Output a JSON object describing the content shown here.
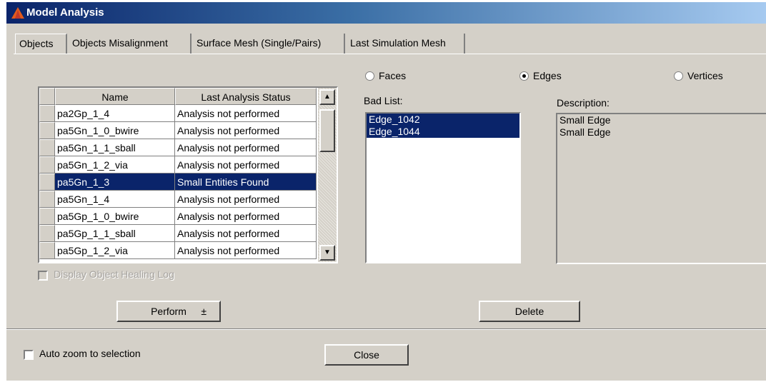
{
  "window": {
    "title": "Model Analysis"
  },
  "tabs": [
    {
      "label": "Objects",
      "active": true
    },
    {
      "label": "Objects Misalignment",
      "active": false
    },
    {
      "label": "Surface Mesh (Single/Pairs)",
      "active": false
    },
    {
      "label": "Last Simulation Mesh",
      "active": false
    }
  ],
  "table": {
    "columns": [
      "Name",
      "Last Analysis Status"
    ],
    "rows": [
      {
        "name": "pa2Gp_1_4",
        "status": "Analysis not performed",
        "selected": false
      },
      {
        "name": "pa5Gn_1_0_bwire",
        "status": "Analysis not performed",
        "selected": false
      },
      {
        "name": "pa5Gn_1_1_sball",
        "status": "Analysis not performed",
        "selected": false
      },
      {
        "name": "pa5Gn_1_2_via",
        "status": "Analysis not performed",
        "selected": false
      },
      {
        "name": "pa5Gn_1_3",
        "status": "Small Entities Found",
        "selected": true
      },
      {
        "name": "pa5Gn_1_4",
        "status": "Analysis not performed",
        "selected": false
      },
      {
        "name": "pa5Gp_1_0_bwire",
        "status": "Analysis not performed",
        "selected": false
      },
      {
        "name": "pa5Gp_1_1_sball",
        "status": "Analysis not performed",
        "selected": false
      },
      {
        "name": "pa5Gp_1_2_via",
        "status": "Analysis not performed",
        "selected": false
      }
    ]
  },
  "healing_log": {
    "label": "Display Object Healing Log",
    "checked": false,
    "enabled": false
  },
  "perform_button": {
    "label": "Perform",
    "arrow": "±"
  },
  "entity_type": {
    "options": [
      {
        "label": "Faces",
        "selected": false
      },
      {
        "label": "Edges",
        "selected": true
      },
      {
        "label": "Vertices",
        "selected": false
      }
    ]
  },
  "bad_list": {
    "label": "Bad List:",
    "items": [
      "Edge_1042",
      "Edge_1044"
    ]
  },
  "description": {
    "label": "Description:",
    "items": [
      "Small Edge",
      "Small Edge"
    ]
  },
  "delete_button": {
    "label": "Delete"
  },
  "auto_zoom": {
    "label": "Auto zoom to selection",
    "checked": false
  },
  "close_button": {
    "label": "Close"
  },
  "colors": {
    "selection": "#0a246a",
    "face": "#d4d0c8",
    "title_start": "#0a246a",
    "title_end": "#a6caf0"
  }
}
